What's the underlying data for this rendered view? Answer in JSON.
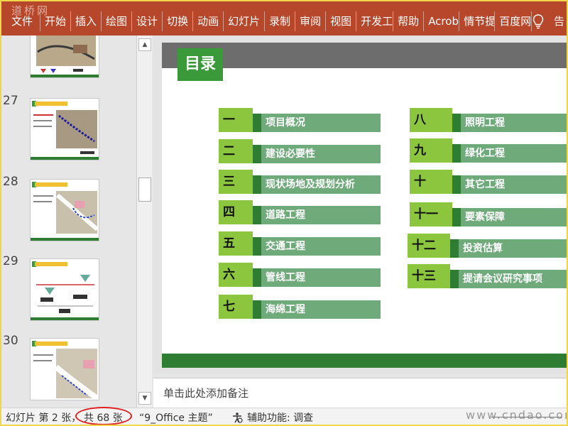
{
  "ribbon": {
    "watermark": "道桥网",
    "tabs": [
      "文件",
      "开始",
      "插入",
      "绘图",
      "设计",
      "切换",
      "动画",
      "幻灯片",
      "录制",
      "审阅",
      "视图",
      "开发工",
      "帮助",
      "Acrob",
      "情节提",
      "百度网"
    ],
    "tell_label": "告",
    "bulb_icon": "lightbulb-icon"
  },
  "thumbnails": [
    {
      "number": ""
    },
    {
      "number": "27"
    },
    {
      "number": "28"
    },
    {
      "number": "29"
    },
    {
      "number": "30"
    }
  ],
  "slide": {
    "title": "目录",
    "toc_left": [
      {
        "num": "一",
        "label": "项目概况"
      },
      {
        "num": "二",
        "label": "建设必要性"
      },
      {
        "num": "三",
        "label": "现状场地及规划分析"
      },
      {
        "num": "四",
        "label": "道路工程"
      },
      {
        "num": "五",
        "label": "交通工程"
      },
      {
        "num": "六",
        "label": "管线工程"
      },
      {
        "num": "七",
        "label": "海绵工程"
      }
    ],
    "toc_right": [
      {
        "num": "八",
        "label": "照明工程"
      },
      {
        "num": "九",
        "label": "绿化工程"
      },
      {
        "num": "十",
        "label": "其它工程"
      },
      {
        "num": "十一",
        "label": "要素保障"
      },
      {
        "num": "十二",
        "label": "投资估算"
      },
      {
        "num": "十三",
        "label": "提请会议研究事项"
      }
    ]
  },
  "notes": {
    "placeholder": "单击此处添加备注"
  },
  "status": {
    "slide_info": "幻灯片 第 2 张，",
    "total": "共 68 张",
    "theme": "“9_Office 主题”",
    "accessibility": "辅助功能: 调查",
    "site_watermark": "www.cndao.com"
  },
  "colors": {
    "ribbon": "#b7472a",
    "green_dark": "#2f7d32",
    "green_light": "#8cc63f",
    "label_green": "#6faa7a",
    "highlight_ring": "#e02020"
  }
}
